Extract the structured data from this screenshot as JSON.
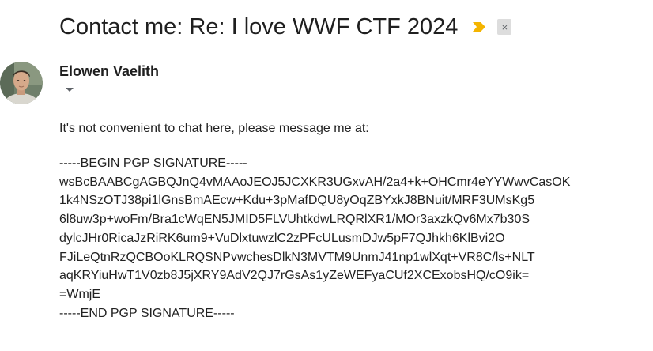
{
  "message": {
    "subject": "Contact me: Re: I love WWF CTF 2024",
    "importance_icon": "importance-marker-icon",
    "label_close_glyph": "×",
    "sender": {
      "name": "Elowen Vaelith",
      "avatar": "avatar-photo",
      "details_icon": "caret-down-icon"
    },
    "body": {
      "intro": "It's not convenient to chat here, please message me at:",
      "pgp_lines": [
        "-----BEGIN PGP SIGNATURE-----",
        "wsBcBAABCgAGBQJnQ4vMAAoJEOJ5JCXKR3UGxvAH/2a4+k+OHCmr4eYYWwvCasOK",
        "1k4NSzOTJ38pi1lGnsBmAEcw+Kdu+3pMafDQU8yOqZBYxkJ8BNuit/MRF3UMsKg5",
        "6l8uw3p+woFm/Bra1cWqEN5JMID5FLVUhtkdwLRQRlXR1/MOr3axzkQv6Mx7b30S",
        "dylcJHr0RicaJzRiRK6um9+VuDlxtuwzlC2zPFcULusmDJw5pF7QJhkh6KlBvi2O",
        "FJiLeQtnRzQCBOoKLRQSNPvwchesDlkN3MVTM9UnmJ41np1wlXqt+VR8C/ls+NLT",
        "aqKRYiuHwT1V0zb8J5jXRY9AdV2QJ7rGsAs1yZeWEFyaCUf2XCExobsHQ/cO9ik=",
        "=WmjE",
        "-----END PGP SIGNATURE-----"
      ]
    }
  },
  "colors": {
    "importance": "#f4b400",
    "chip_bg": "#dddddd",
    "text": "#222222"
  }
}
